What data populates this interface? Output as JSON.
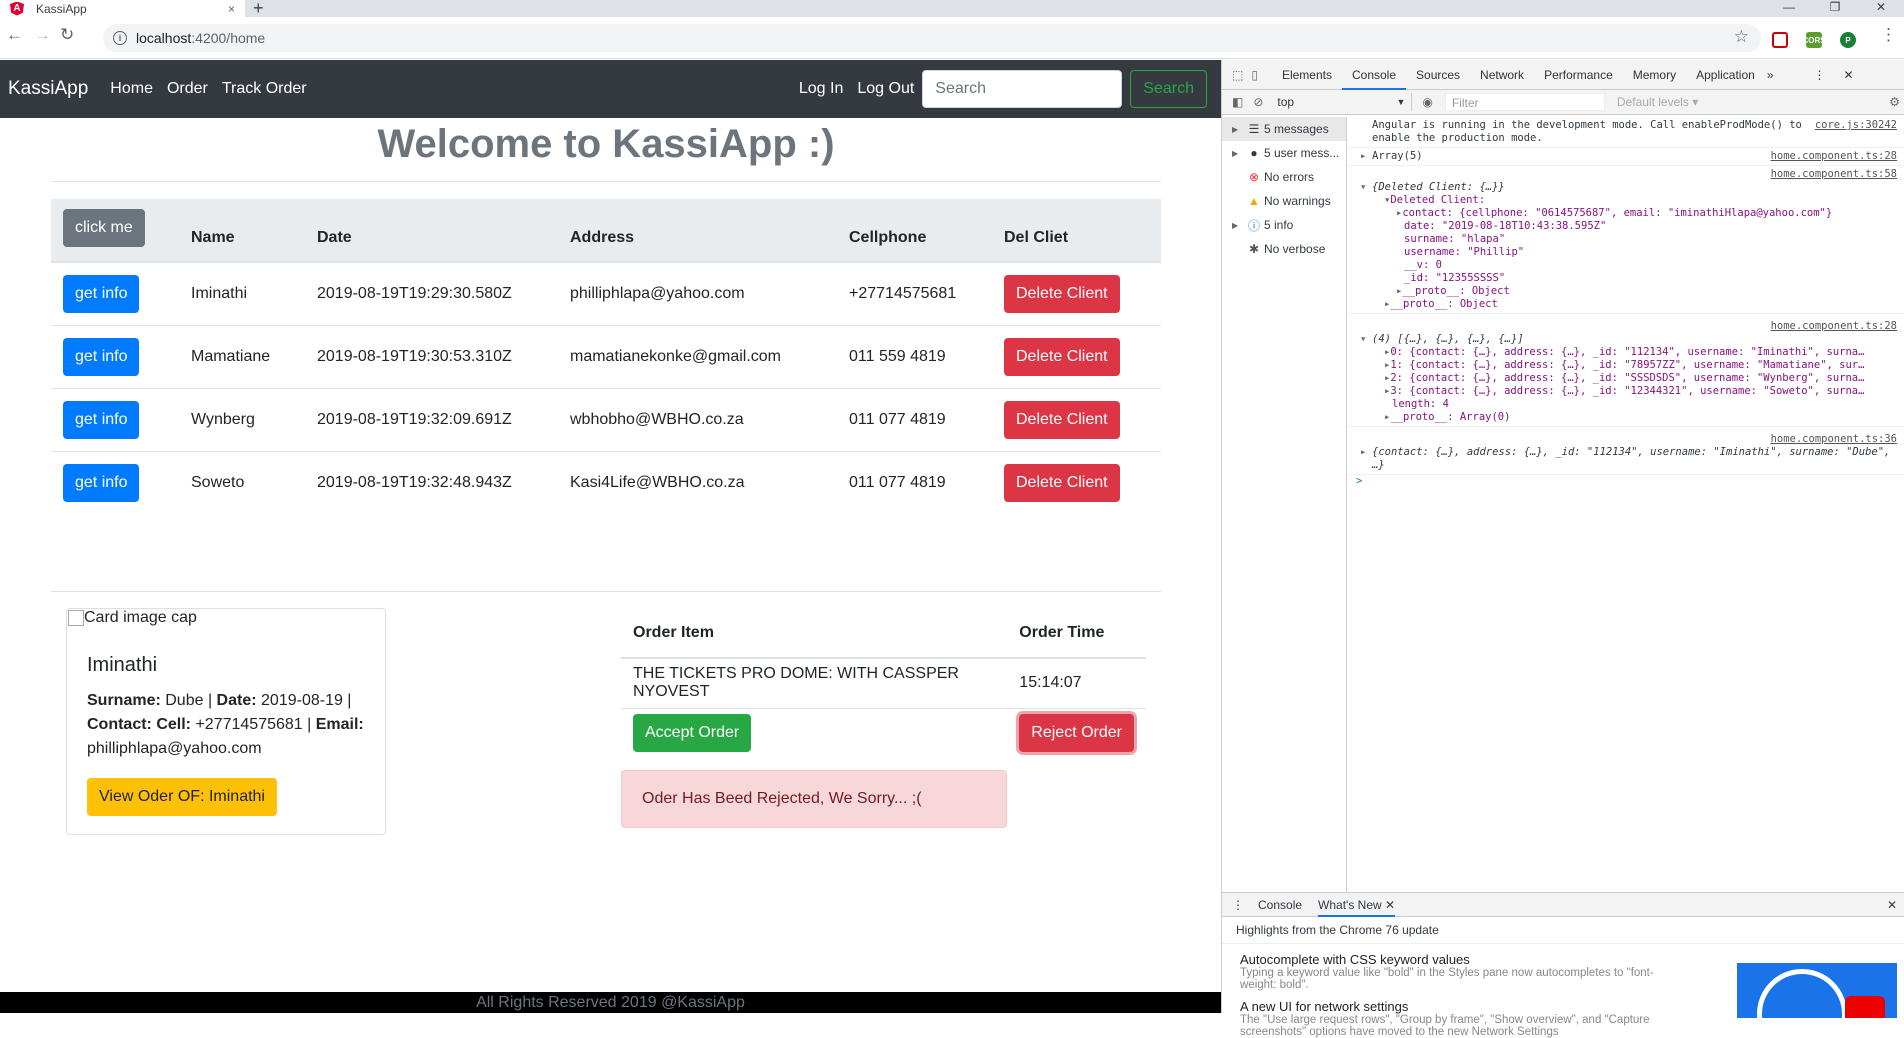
{
  "browser": {
    "tab_title": "KassiApp",
    "tab_logo": "A",
    "tab_close": "×",
    "new_tab": "+",
    "url_host": "localhost",
    "url_path": ":4200/home",
    "ext_badge": "CORS",
    "profile": "P"
  },
  "navbar": {
    "brand": "KassiApp",
    "links": [
      "Home",
      "Order",
      "Track Order"
    ],
    "login": "Log In",
    "logout": "Log Out",
    "search_placeholder": "Search",
    "search_button": "Search"
  },
  "welcome": "Welcome to KassiApp :)",
  "clients_table": {
    "header_button": "click me",
    "columns": [
      "Name",
      "Date",
      "Address",
      "Cellphone",
      "Del Cliet"
    ],
    "row_button": "get info",
    "delete_button": "Delete Client",
    "rows": [
      {
        "name": "Iminathi",
        "date": "2019-08-19T19:29:30.580Z",
        "address": "philliphlapa@yahoo.com",
        "cell": "+27714575681"
      },
      {
        "name": "Mamatiane",
        "date": "2019-08-19T19:30:53.310Z",
        "address": "mamatianekonke@gmail.com",
        "cell": "011 559 4819"
      },
      {
        "name": "Wynberg",
        "date": "2019-08-19T19:32:09.691Z",
        "address": "wbhobho@WBHO.co.za",
        "cell": "011 077 4819"
      },
      {
        "name": "Soweto",
        "date": "2019-08-19T19:32:48.943Z",
        "address": "Kasi4Life@WBHO.co.za",
        "cell": "011 077 4819"
      }
    ]
  },
  "card": {
    "image_alt": "Card image cap",
    "title": "Iminathi",
    "surname_label": "Surname:",
    "surname": "Dube",
    "date_label": "Date:",
    "date": "2019-08-19",
    "contact_label": "Contact: Cell:",
    "cell": "+27714575681",
    "email_label": "Email:",
    "email": "philliphlapa@yahoo.com",
    "button": "View Oder OF: Iminathi"
  },
  "orders": {
    "col_item": "Order Item",
    "col_time": "Order Time",
    "item": "THE TICKETS PRO DOME: WITH CASSPER NYOVEST",
    "time": "15:14:07",
    "accept": "Accept Order",
    "reject": "Reject Order",
    "alert": "Oder Has Beed Rejected, We Sorry... ;("
  },
  "footer": "All Rights Reserved 2019 @KassiApp",
  "devtools": {
    "tabs": [
      "Elements",
      "Console",
      "Sources",
      "Network",
      "Performance",
      "Memory",
      "Application"
    ],
    "context": "top",
    "filter_placeholder": "Filter",
    "levels": "Default levels ▾",
    "sidebar": [
      {
        "label": "5 messages",
        "icon": "list-icon"
      },
      {
        "label": "5 user mess...",
        "icon": "user-icon"
      },
      {
        "label": "No errors",
        "icon": "error-icon"
      },
      {
        "label": "No warnings",
        "icon": "warning-icon"
      },
      {
        "label": "5 info",
        "icon": "info-icon"
      },
      {
        "label": "No verbose",
        "icon": "bug-icon"
      }
    ],
    "console": {
      "m1_text": "Angular is running in the development mode. Call enableProdMode() to enable the production mode.",
      "m1_src": "core.js:30242",
      "m2_text": "Array(5)",
      "m2_src": "home.component.ts:28",
      "m3_src": "home.component.ts:58",
      "m3_head": "{Deleted Client: {…}}",
      "m3_key": "Deleted Client:",
      "m3_contact": "contact: {cellphone: \"0614575687\", email: \"iminathiHlapa@yahoo.com\"}",
      "m3_date": "date: \"2019-08-18T10:43:38.595Z\"",
      "m3_surname": "surname: \"hlapa\"",
      "m3_username": "username: \"Phillip\"",
      "m3_v": "__v: 0",
      "m3_id": "_id: \"12355SSSS\"",
      "m3_proto1": "__proto__: Object",
      "m3_proto2": "__proto__: Object",
      "m4_src": "home.component.ts:28",
      "m4_head": "(4) [{…}, {…}, {…}, {…}]",
      "m4_r0": "0: {contact: {…}, address: {…}, _id: \"112134\", username: \"Iminathi\", surna…",
      "m4_r1": "1: {contact: {…}, address: {…}, _id: \"78957ZZ\", username: \"Mamatiane\", sur…",
      "m4_r2": "2: {contact: {…}, address: {…}, _id: \"SSSDSDS\", username: \"Wynberg\", surna…",
      "m4_r3": "3: {contact: {…}, address: {…}, _id: \"12344321\", username: \"Soweto\", surna…",
      "m4_len": "length: 4",
      "m4_proto": "__proto__: Array(0)",
      "m5_src": "home.component.ts:36",
      "m5_text": "{contact: {…}, address: {…}, _id: \"112134\", username: \"Iminathi\", surname: \"Dube\", …}",
      "prompt": ">"
    },
    "drawer": {
      "tabs": [
        "Console",
        "What's New"
      ],
      "header": "Highlights from the Chrome 76 update",
      "items": [
        {
          "title": "Autocomplete with CSS keyword values",
          "desc": "Typing a keyword value like \"bold\" in the Styles pane now autocompletes to \"font-weight: bold\"."
        },
        {
          "title": "A new UI for network settings",
          "desc": "The \"Use large request rows\", \"Group by frame\", \"Show overview\", and \"Capture screenshots\" options have moved to the new Network Settings"
        }
      ]
    }
  },
  "colors": {
    "navbar": "#343a40",
    "primary": "#007bff",
    "danger": "#dc3545",
    "success": "#28a745",
    "warning": "#ffc107",
    "alert_bg": "#f8d7da"
  }
}
